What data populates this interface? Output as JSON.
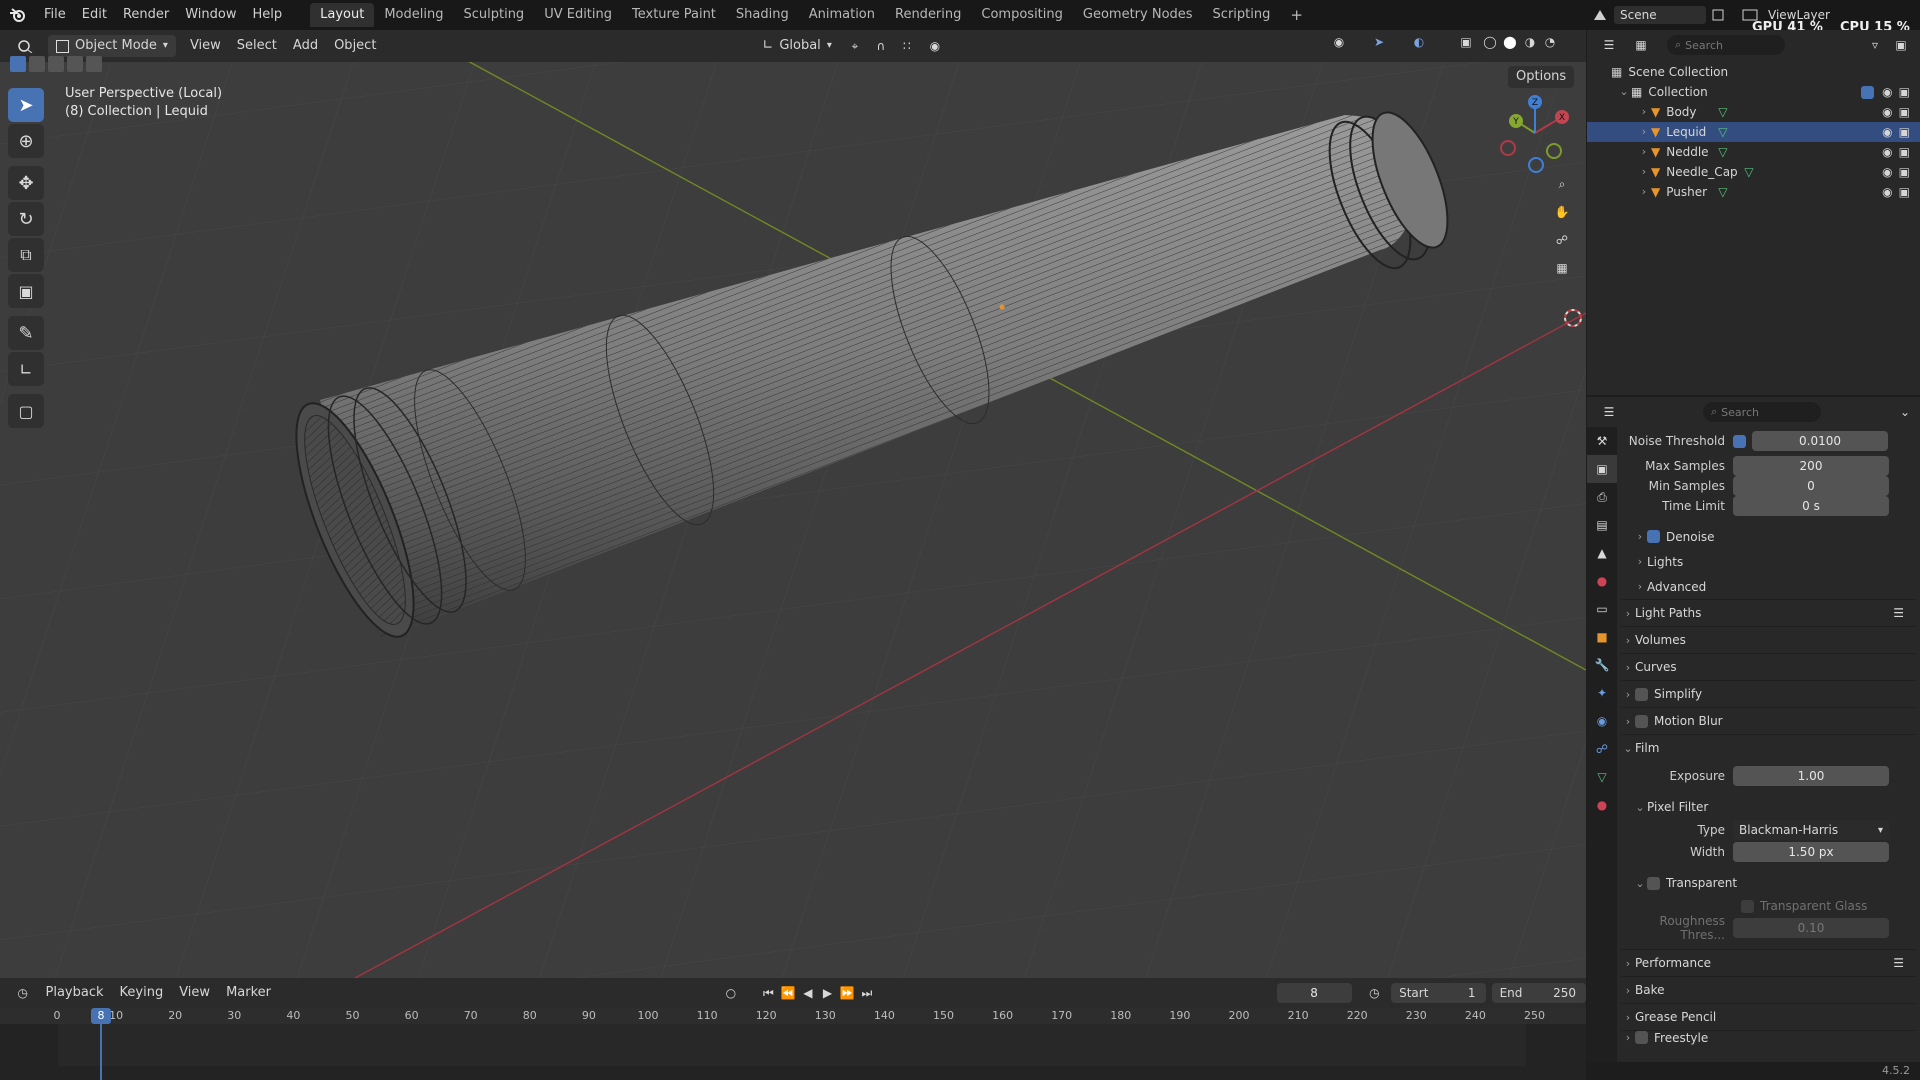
{
  "top_menu": [
    "File",
    "Edit",
    "Render",
    "Window",
    "Help"
  ],
  "workspaces": [
    "Layout",
    "Modeling",
    "Sculpting",
    "UV Editing",
    "Texture Paint",
    "Shading",
    "Animation",
    "Rendering",
    "Compositing",
    "Geometry Nodes",
    "Scripting"
  ],
  "active_workspace": "Layout",
  "add_workspace": "+",
  "scene": {
    "label": "Scene",
    "view_layer": "ViewLayer",
    "gpu": "GPU 41 %",
    "cpu": "CPU 15 %"
  },
  "viewport": {
    "mode": "Object Mode",
    "menus": [
      "View",
      "Select",
      "Add",
      "Object"
    ],
    "transform_orientation": "Global",
    "options": "Options",
    "overlay_line1": "User Perspective (Local)",
    "overlay_line2": "(8) Collection | Lequid",
    "gizmo": {
      "x": "X",
      "y": "Y",
      "z": "Z"
    }
  },
  "outliner": {
    "search_placeholder": "Search",
    "scene_collection": "Scene Collection",
    "collection": "Collection",
    "items": [
      "Body",
      "Lequid",
      "Neddle",
      "Needle_Cap",
      "Pusher"
    ]
  },
  "properties": {
    "search_placeholder": "Search",
    "noise_threshold": {
      "label": "Noise Threshold",
      "value": "0.0100",
      "checked": true
    },
    "max_samples": {
      "label": "Max Samples",
      "value": "200"
    },
    "min_samples": {
      "label": "Min Samples",
      "value": "0"
    },
    "time_limit": {
      "label": "Time Limit",
      "value": "0 s"
    },
    "denoise": "Denoise",
    "lights": "Lights",
    "advanced": "Advanced",
    "light_paths": "Light Paths",
    "volumes": "Volumes",
    "curves": "Curves",
    "simplify": "Simplify",
    "motion_blur": "Motion Blur",
    "film": "Film",
    "exposure": {
      "label": "Exposure",
      "value": "1.00"
    },
    "pixel_filter": "Pixel Filter",
    "filter_type": {
      "label": "Type",
      "value": "Blackman-Harris"
    },
    "filter_width": {
      "label": "Width",
      "value": "1.50 px"
    },
    "transparent": "Transparent",
    "transparent_glass": "Transparent Glass",
    "roughness": {
      "label": "Roughness Thres...",
      "value": "0.10"
    },
    "performance": "Performance",
    "bake": "Bake",
    "grease_pencil": "Grease Pencil",
    "freestyle": "Freestyle"
  },
  "timeline": {
    "menus": [
      "Playback",
      "Keying",
      "View",
      "Marker"
    ],
    "current_frame": "8",
    "start_label": "Start",
    "start": "1",
    "end_label": "End",
    "end": "250",
    "ruler": [
      "0",
      "10",
      "20",
      "30",
      "40",
      "50",
      "60",
      "70",
      "80",
      "90",
      "100",
      "110",
      "120",
      "130",
      "140",
      "150",
      "160",
      "170",
      "180",
      "190",
      "200",
      "210",
      "220",
      "230",
      "240",
      "250"
    ],
    "playhead_label": "8"
  },
  "version": "4.5.2",
  "colors": {
    "accent": "#4772b3",
    "x_axis": "#b03a48",
    "y_axis": "#7e9c2a",
    "z_axis": "#3f7fd6",
    "object_orange": "#e6952c",
    "mesh_green": "#58c27c"
  }
}
